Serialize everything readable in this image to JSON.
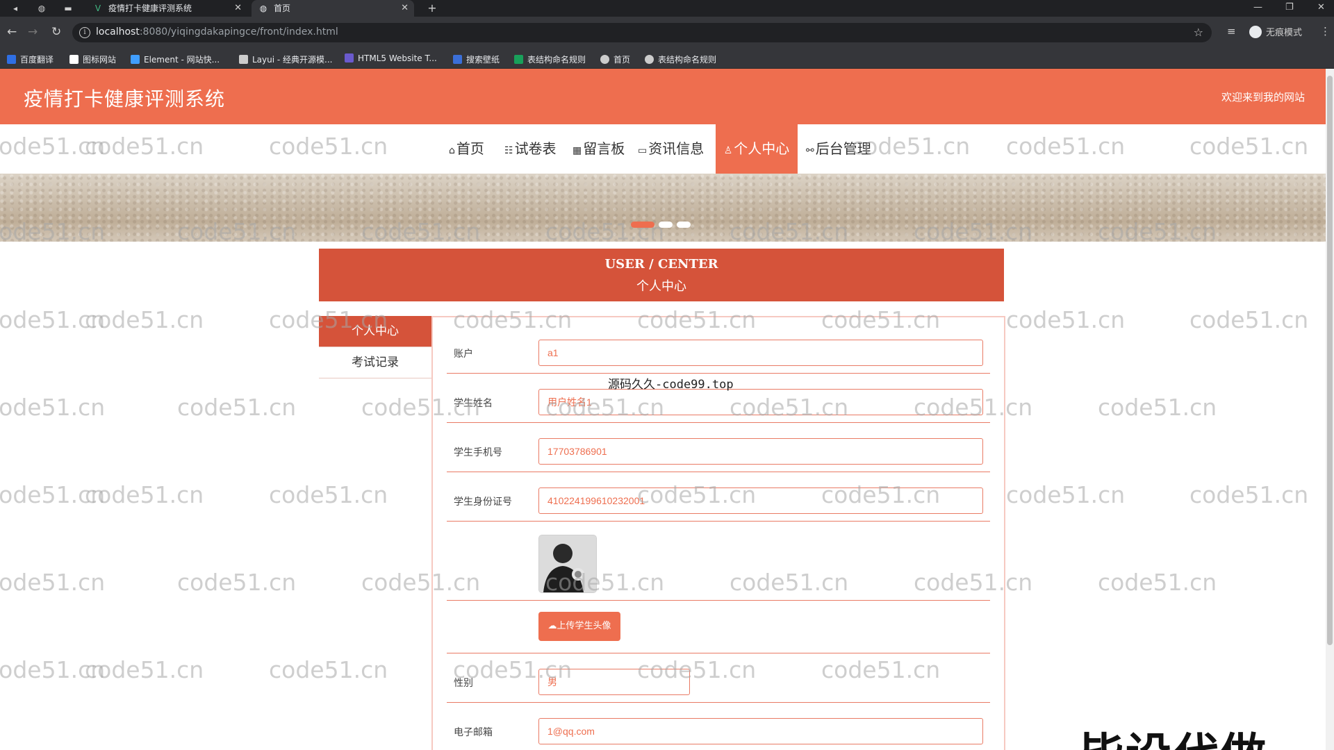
{
  "browser": {
    "tabs": [
      {
        "title": "疫情打卡健康评测系统",
        "active": false,
        "icon": "vue-logo-icon"
      },
      {
        "title": "首页",
        "active": true,
        "icon": "globe-icon"
      }
    ],
    "url_host": "localhost",
    "url_path": ":8080/yiqingdakapingce/front/index.html",
    "profile_label": "无痕模式",
    "bookmarks": [
      {
        "label": "百度翻译",
        "color": "#2f6fe4"
      },
      {
        "label": "图标网站",
        "color": "#ffffff"
      },
      {
        "label": "Element - 网站快...",
        "color": "#409eff"
      },
      {
        "label": "Layui - 经典开源模...",
        "color": "#cccccc"
      },
      {
        "label": "HTML5 Website T...",
        "color": "#6a5acd"
      },
      {
        "label": "搜索壁纸",
        "color": "#3b6fd8"
      },
      {
        "label": "表结构命名规则",
        "color": "#19a05a"
      },
      {
        "label": "首页",
        "color": "#cccccc"
      },
      {
        "label": "表结构命名规则",
        "color": "#cccccc"
      }
    ]
  },
  "site": {
    "title": "疫情打卡健康评测系统",
    "welcome": "欢迎来到我的网站",
    "brand_color": "#ee6e4f"
  },
  "nav": {
    "items": [
      {
        "label": "首页",
        "icon": "home-icon"
      },
      {
        "label": "试卷表",
        "icon": "list-icon"
      },
      {
        "label": "留言板",
        "icon": "grid-icon"
      },
      {
        "label": "资讯信息",
        "icon": "message-icon"
      },
      {
        "label": "个人中心",
        "icon": "user-icon",
        "active": true
      },
      {
        "label": "后台管理",
        "icon": "link-icon"
      }
    ]
  },
  "banner": {
    "slide_count": 3,
    "active_slide": 1
  },
  "user_center": {
    "title_en": "USER / CENTER",
    "title_zh": "个人中心"
  },
  "side_menu": [
    {
      "label": "个人中心",
      "active": true
    },
    {
      "label": "考试记录",
      "active": false
    }
  ],
  "form": {
    "account": {
      "label": "账户",
      "value": "a1"
    },
    "name": {
      "label": "学生姓名",
      "value": "用户姓名1"
    },
    "phone": {
      "label": "学生手机号",
      "value": "17703786901"
    },
    "id_card": {
      "label": "学生身份证号",
      "value": "410224199610232001"
    },
    "avatar_icon": "avatar-photo",
    "upload_label": "上传学生头像",
    "gender": {
      "label": "性别",
      "value": "男"
    },
    "email": {
      "label": "电子邮箱",
      "value": "1@qq.com"
    }
  },
  "overlays": {
    "watermark": "code51.cn",
    "center_text": "源码久久-code99.top",
    "corner_text": "毕设代做"
  }
}
